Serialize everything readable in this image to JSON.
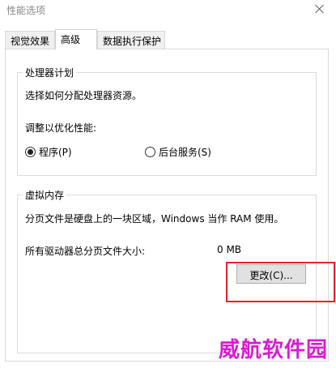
{
  "window": {
    "title": "性能选项"
  },
  "tabs": [
    {
      "label": "视觉效果"
    },
    {
      "label": "高级"
    },
    {
      "label": "数据执行保护"
    }
  ],
  "processor_scheduling": {
    "heading": "处理器计划",
    "description": "选择如何分配处理器资源。",
    "optimize_label": "调整以优化性能:",
    "options": [
      {
        "label": "程序(P)",
        "selected": true
      },
      {
        "label": "后台服务(S)",
        "selected": false
      }
    ]
  },
  "virtual_memory": {
    "heading": "虚拟内存",
    "description": "分页文件是硬盘上的一块区域，Windows 当作 RAM 使用。",
    "total_label": "所有驱动器总分页文件大小:",
    "total_value": "0 MB",
    "change_button": "更改(C)..."
  },
  "watermark": "威航软件园",
  "colors": {
    "highlight": "#e0232d",
    "watermark": "#d81dd0"
  }
}
